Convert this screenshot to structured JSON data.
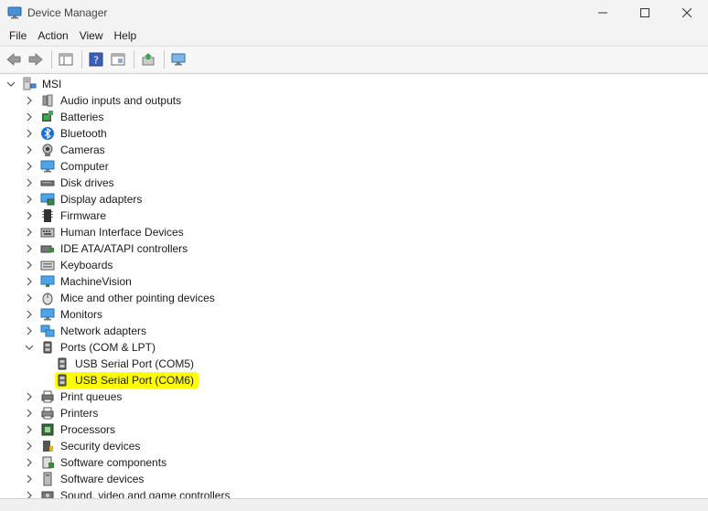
{
  "window": {
    "title": "Device Manager"
  },
  "menu": {
    "items": [
      "File",
      "Action",
      "View",
      "Help"
    ]
  },
  "toolbar": {
    "buttons": [
      "back-icon",
      "forward-icon",
      "properties-pane-icon",
      "help-icon",
      "show-hidden-icon",
      "update-driver-icon",
      "scan-hardware-icon"
    ]
  },
  "tree": {
    "root": "MSI",
    "categories": [
      {
        "label": "Audio inputs and outputs",
        "icon": "speaker-icon"
      },
      {
        "label": "Batteries",
        "icon": "battery-icon"
      },
      {
        "label": "Bluetooth",
        "icon": "bluetooth-icon"
      },
      {
        "label": "Cameras",
        "icon": "camera-icon"
      },
      {
        "label": "Computer",
        "icon": "computer-icon"
      },
      {
        "label": "Disk drives",
        "icon": "disk-icon"
      },
      {
        "label": "Display adapters",
        "icon": "display-adapter-icon"
      },
      {
        "label": "Firmware",
        "icon": "firmware-icon"
      },
      {
        "label": "Human Interface Devices",
        "icon": "hid-icon"
      },
      {
        "label": "IDE ATA/ATAPI controllers",
        "icon": "ide-icon"
      },
      {
        "label": "Keyboards",
        "icon": "keyboard-icon"
      },
      {
        "label": "MachineVision",
        "icon": "machinevision-icon"
      },
      {
        "label": "Mice and other pointing devices",
        "icon": "mouse-icon"
      },
      {
        "label": "Monitors",
        "icon": "monitor-icon"
      },
      {
        "label": "Network adapters",
        "icon": "network-icon"
      },
      {
        "label": "Ports (COM & LPT)",
        "icon": "port-icon",
        "expanded": true,
        "children": [
          {
            "label": "USB Serial Port (COM5)",
            "icon": "port-icon",
            "highlighted": false
          },
          {
            "label": "USB Serial Port (COM6)",
            "icon": "port-icon",
            "highlighted": true
          }
        ]
      },
      {
        "label": "Print queues",
        "icon": "print-queue-icon"
      },
      {
        "label": "Printers",
        "icon": "printer-icon"
      },
      {
        "label": "Processors",
        "icon": "processor-icon"
      },
      {
        "label": "Security devices",
        "icon": "security-icon"
      },
      {
        "label": "Software components",
        "icon": "software-component-icon"
      },
      {
        "label": "Software devices",
        "icon": "software-device-icon"
      },
      {
        "label": "Sound, video and game controllers",
        "icon": "sound-icon"
      }
    ]
  },
  "colors": {
    "highlight": "#ffff00",
    "accent": "#0078d4"
  }
}
